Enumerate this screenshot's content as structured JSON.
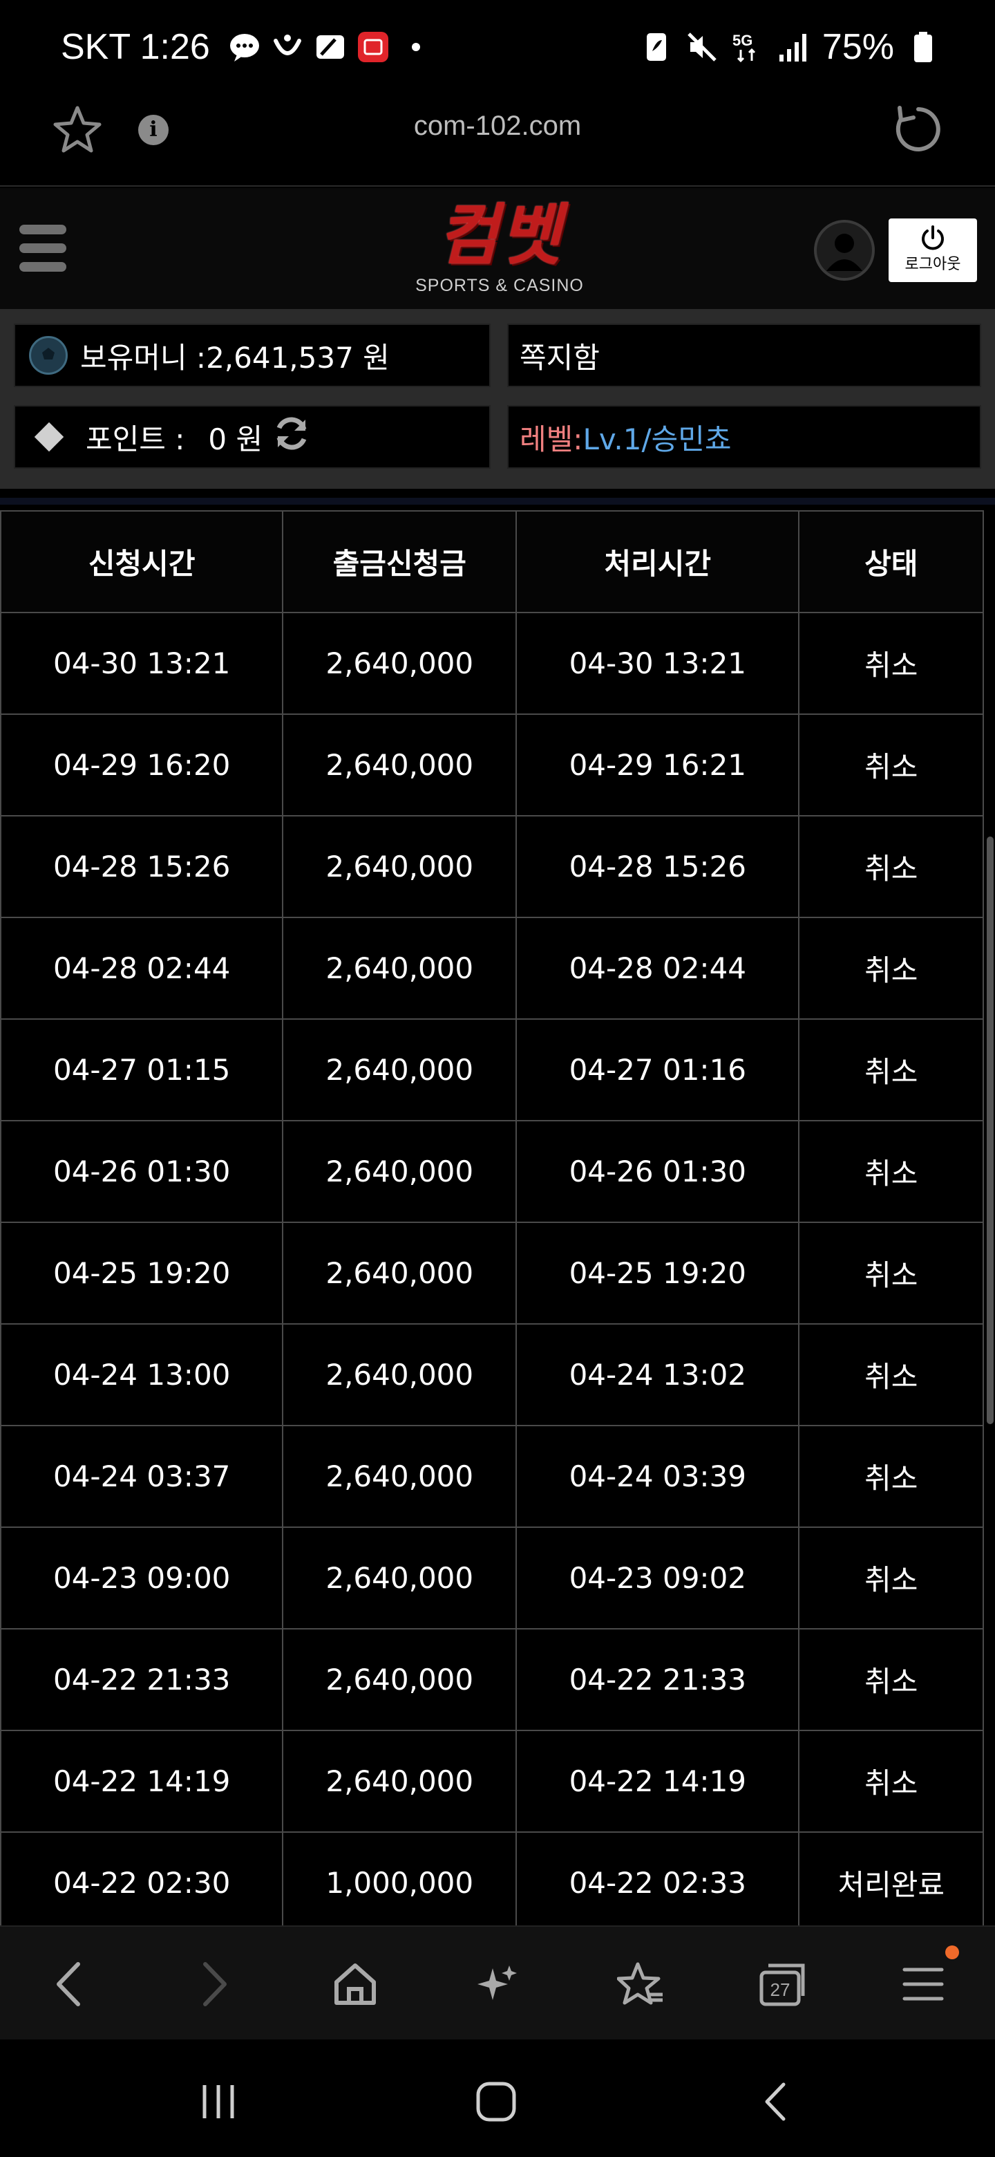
{
  "status_bar": {
    "carrier_time": "SKT 1:26",
    "network": "5G",
    "battery": "75%"
  },
  "browser": {
    "url": "com-102.com"
  },
  "site": {
    "logo_text": "컴벳",
    "logo_sub": "SPORTS & CASINO",
    "logout_label": "로그아웃"
  },
  "account": {
    "money_label": "보유머니 :",
    "money_value": "2,641,537 원",
    "message_box": "쪽지함",
    "point_label": "포인트 :",
    "point_value": "0 원",
    "level_label": "레벨:",
    "level_value": "Lv.1/승민쵸"
  },
  "table": {
    "headers": [
      "신청시간",
      "출금신청금",
      "처리시간",
      "상태"
    ],
    "rows": [
      [
        "04-30 13:21",
        "2,640,000",
        "04-30 13:21",
        "취소"
      ],
      [
        "04-29 16:20",
        "2,640,000",
        "04-29 16:21",
        "취소"
      ],
      [
        "04-28 15:26",
        "2,640,000",
        "04-28 15:26",
        "취소"
      ],
      [
        "04-28 02:44",
        "2,640,000",
        "04-28 02:44",
        "취소"
      ],
      [
        "04-27 01:15",
        "2,640,000",
        "04-27 01:16",
        "취소"
      ],
      [
        "04-26 01:30",
        "2,640,000",
        "04-26 01:30",
        "취소"
      ],
      [
        "04-25 19:20",
        "2,640,000",
        "04-25 19:20",
        "취소"
      ],
      [
        "04-24 13:00",
        "2,640,000",
        "04-24 13:02",
        "취소"
      ],
      [
        "04-24 03:37",
        "2,640,000",
        "04-24 03:39",
        "취소"
      ],
      [
        "04-23 09:00",
        "2,640,000",
        "04-23 09:02",
        "취소"
      ],
      [
        "04-22 21:33",
        "2,640,000",
        "04-22 21:33",
        "취소"
      ],
      [
        "04-22 14:19",
        "2,640,000",
        "04-22 14:19",
        "취소"
      ],
      [
        "04-22 02:30",
        "1,000,000",
        "04-22 02:33",
        "처리완료"
      ]
    ]
  },
  "toolbar": {
    "tabs_count": "27"
  }
}
